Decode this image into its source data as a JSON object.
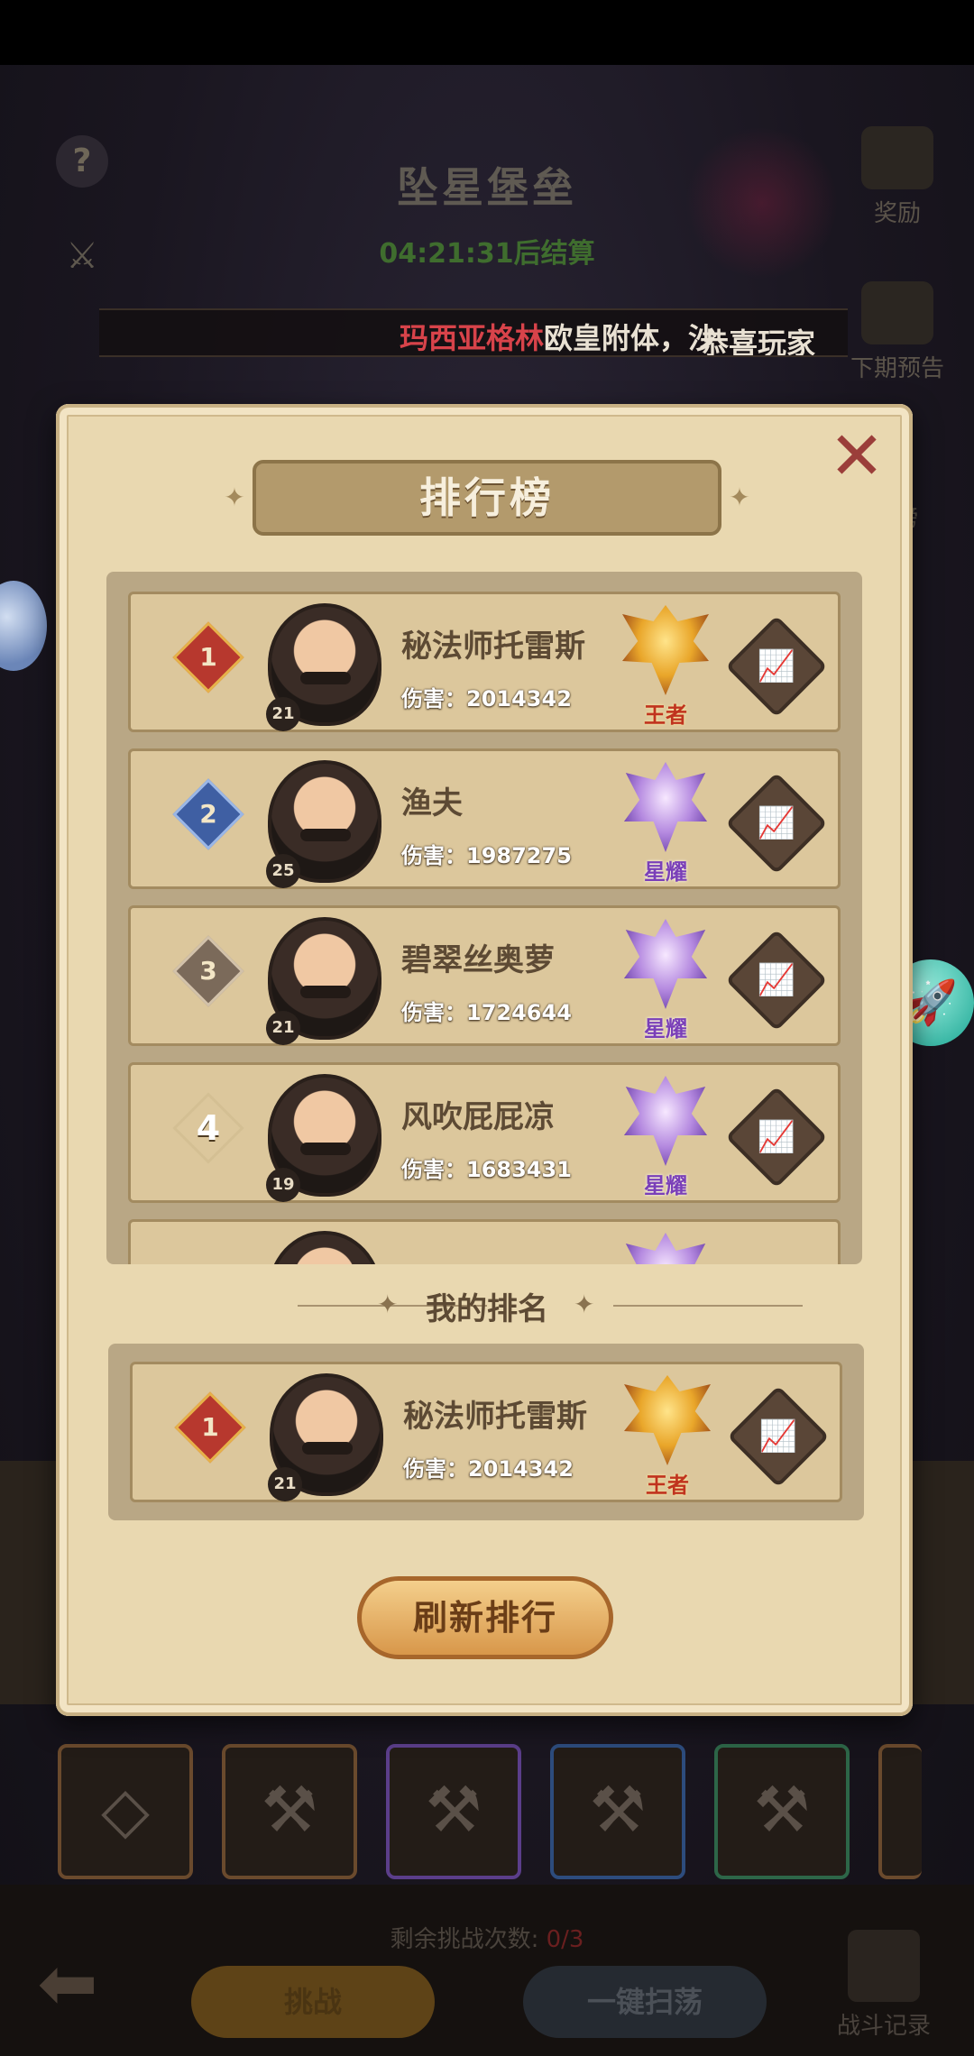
{
  "background": {
    "title": "坠星堡垒",
    "timer": "04:21:31后结算",
    "help_icon": "question-icon",
    "reward_label": "奖励",
    "next_preview_label": "下期预告",
    "ranking_side_label": "榜",
    "marquee_prefix": "恭喜玩家",
    "marquee_player": "玛西亚格林",
    "marquee_suffix": "欧皇附体，",
    "marquee_tail": "沙",
    "remaining_label": "剩余挑战次数:",
    "remaining_value": "0/3",
    "challenge_button": "挑战",
    "sweep_button": "一键扫荡",
    "battle_log_label": "战斗记录"
  },
  "modal": {
    "title": "排行榜",
    "close_icon": "close-icon",
    "my_rank_title": "我的排名",
    "refresh_button": "刷新排行",
    "damage_prefix": "伤害：",
    "rows": [
      {
        "rank": "1",
        "name": "秘法师托雷斯",
        "damage": "2014342",
        "level": "21",
        "tier": "王者",
        "tier_color": "gold"
      },
      {
        "rank": "2",
        "name": "渔夫",
        "damage": "1987275",
        "level": "25",
        "tier": "星耀",
        "tier_color": "purple"
      },
      {
        "rank": "3",
        "name": "碧翠丝奥萝",
        "damage": "1724644",
        "level": "21",
        "tier": "星耀",
        "tier_color": "purple"
      },
      {
        "rank": "4",
        "name": "风吹屁屁凉",
        "damage": "1683431",
        "level": "19",
        "tier": "星耀",
        "tier_color": "purple"
      }
    ],
    "my_row": {
      "rank": "1",
      "name": "秘法师托雷斯",
      "damage": "2014342",
      "level": "21",
      "tier": "王者",
      "tier_color": "gold"
    }
  },
  "colors": {
    "highlight_name": "#d8434a",
    "tier_gold": "#c0331e",
    "tier_purple": "#7a3fb8",
    "panel": "#e9d8b0"
  }
}
